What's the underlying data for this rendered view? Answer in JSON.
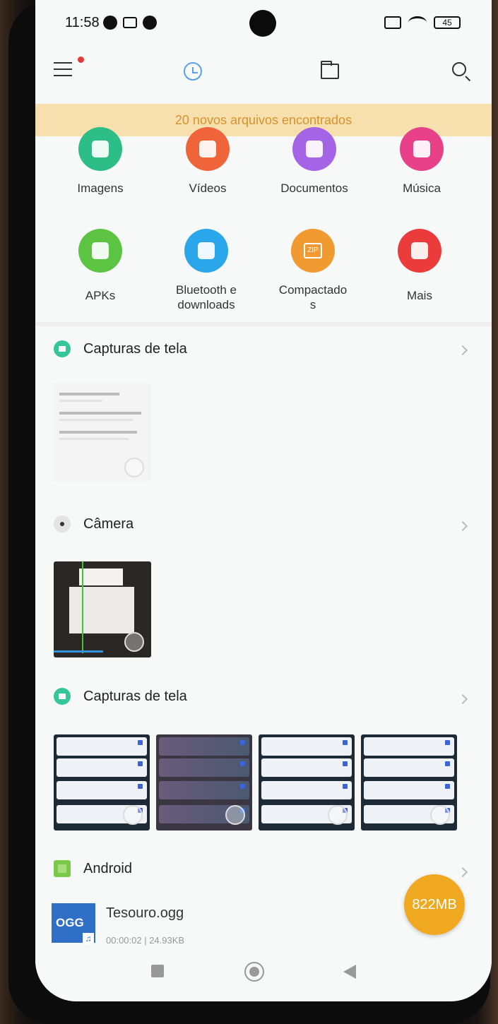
{
  "status_bar": {
    "time": "11:58",
    "battery": "45"
  },
  "banner": {
    "text": "20 novos arquivos encontrados"
  },
  "categories": [
    {
      "label": "Imagens",
      "color": "#2dbd86",
      "icon": "image-icon"
    },
    {
      "label": "Vídeos",
      "color": "#f0643a",
      "icon": "video-icon"
    },
    {
      "label": "Documentos",
      "color": "#a564e6",
      "icon": "document-icon"
    },
    {
      "label": "Música",
      "color": "#e9408a",
      "icon": "music-icon"
    },
    {
      "label": "APKs",
      "color": "#5dc443",
      "icon": "android-icon"
    },
    {
      "label": "Bluetooth e downloads",
      "color": "#2aa6ea",
      "icon": "bluetooth-download-icon"
    },
    {
      "label": "Compactado s",
      "color": "#f19a31",
      "icon": "zip-icon",
      "glyph_text": "ZIP"
    },
    {
      "label": "Mais",
      "color": "#ec3b3b",
      "icon": "grid-icon"
    }
  ],
  "sections": [
    {
      "title": "Capturas de tela"
    },
    {
      "title": "Câmera"
    },
    {
      "title": "Capturas de tela"
    },
    {
      "title": "Android"
    }
  ],
  "file": {
    "name": "Tesouro.ogg",
    "meta": "00:00:02 | 24.93KB",
    "badge": "OGG"
  },
  "storage": {
    "label": "822MB"
  }
}
